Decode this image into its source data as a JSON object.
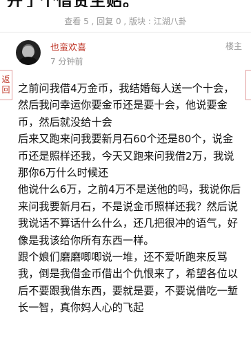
{
  "thread": {
    "title_partial": "开了个借贷主贴。"
  },
  "meta": {
    "views_label": "查看 5 , 回复 0 , 版块 : 江湖八卦"
  },
  "post": {
    "username": "也蛮欢喜",
    "time": "7 分钟前",
    "floor": "楼主",
    "paragraphs": [
      "之前问我借4万金币，我结婚每人送一个十会，然后我问幸运你要金币还是要十会，他说要金币，然后就没给十会",
      "后来又跑来问我要新月石60个还是80个，说金币还是照样还我，今天又跑来问我借2万，我说那你6万什么时候还",
      "他说什么6万，之前4万不是送他的吗，我说你后来问我要新月石，不是说金币照样还我？然后说我说话不算话什么什么，还几把很冲的语气，好像是我该给你所有东西一样。",
      "跟个娘们磨磨唧唧说一堆，还不爱听跑来反骂我，倒是我借金币借出个仇恨来了，希望各位以后不要跟我借东西，要就是要，不要说借吃一堑长一智，真你妈人心的飞起"
    ]
  },
  "side": {
    "back_label": "返回"
  }
}
